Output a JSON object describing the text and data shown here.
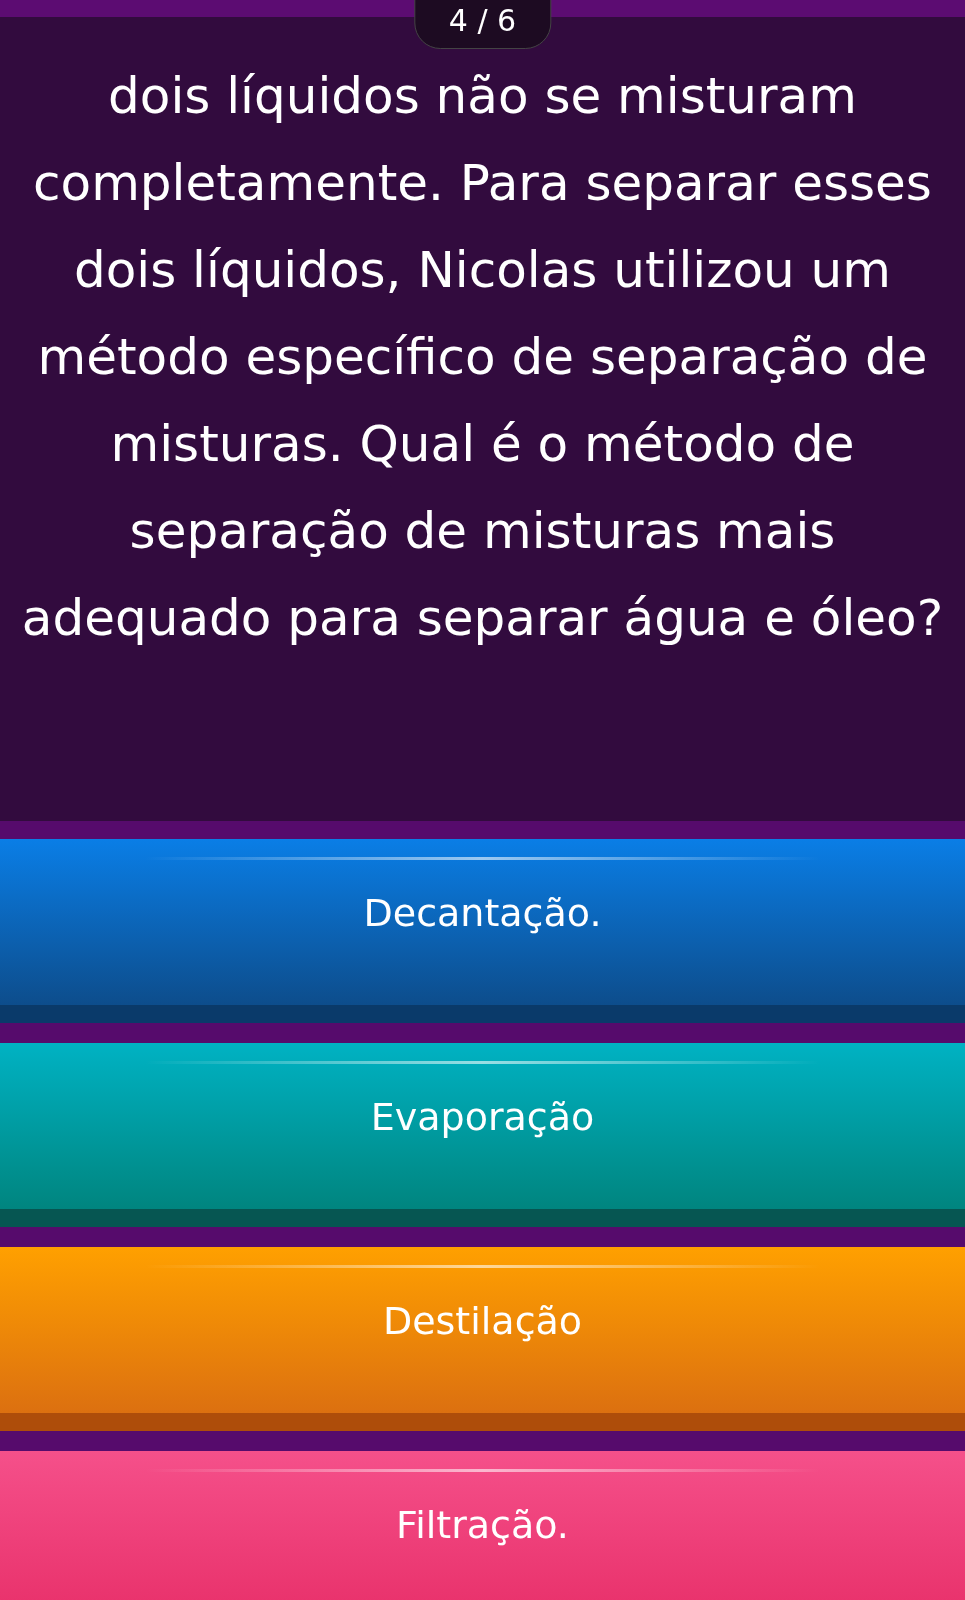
{
  "counter": "4 / 6",
  "question": "dois líquidos não se misturam completamente. Para separar esses dois líquidos, Nicolas utilizou um método específico de separação de misturas. Qual é o método de separação de misturas mais adequado para separar água e óleo?",
  "options": [
    {
      "label": "Decantação.",
      "kind": "blue"
    },
    {
      "label": "Evaporação",
      "kind": "teal"
    },
    {
      "label": "Destilação",
      "kind": "orange"
    },
    {
      "label": "Filtração.",
      "kind": "pink"
    }
  ]
}
